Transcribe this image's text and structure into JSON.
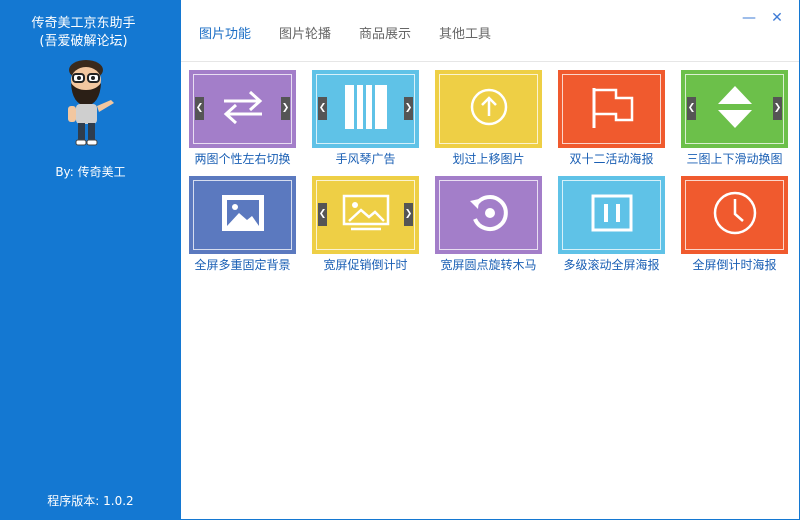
{
  "app": {
    "title_line1": "传奇美工京东助手",
    "title_line2": "(吾爱破解论坛)",
    "author": "By: 传奇美工",
    "version": "程序版本: 1.0.2"
  },
  "window": {
    "minimize": "—",
    "close": "✕"
  },
  "tabs": [
    {
      "label": "图片功能",
      "active": true
    },
    {
      "label": "图片轮播",
      "active": false
    },
    {
      "label": "商品展示",
      "active": false
    },
    {
      "label": "其他工具",
      "active": false
    }
  ],
  "tiles": [
    {
      "label": "两图个性左右切换",
      "color": "#a37ec9",
      "icon": "swap-arrows-icon",
      "nav": true
    },
    {
      "label": "手风琴广告",
      "color": "#5fc2e7",
      "icon": "accordion-bars-icon",
      "nav": true
    },
    {
      "label": "划过上移图片",
      "color": "#eecf45",
      "icon": "up-circle-icon",
      "nav": false
    },
    {
      "label": "双十二活动海报",
      "color": "#f05a2e",
      "icon": "flag-icon",
      "nav": false
    },
    {
      "label": "三图上下滑动换图",
      "color": "#6cc04a",
      "icon": "up-down-triangles-icon",
      "nav": true
    },
    {
      "label": "全屏多重固定背景",
      "color": "#5b79bf",
      "icon": "image-icon",
      "nav": false
    },
    {
      "label": "宽屏促销倒计时",
      "color": "#eecf45",
      "icon": "landscape-icon",
      "nav": true
    },
    {
      "label": "宽屏圆点旋转木马",
      "color": "#a37ec9",
      "icon": "rotate-icon",
      "nav": false
    },
    {
      "label": "多级滚动全屏海报",
      "color": "#5fc2e7",
      "icon": "pause-icon",
      "nav": false
    },
    {
      "label": "全屏倒计时海报",
      "color": "#f05a2e",
      "icon": "clock-icon",
      "nav": false
    }
  ]
}
